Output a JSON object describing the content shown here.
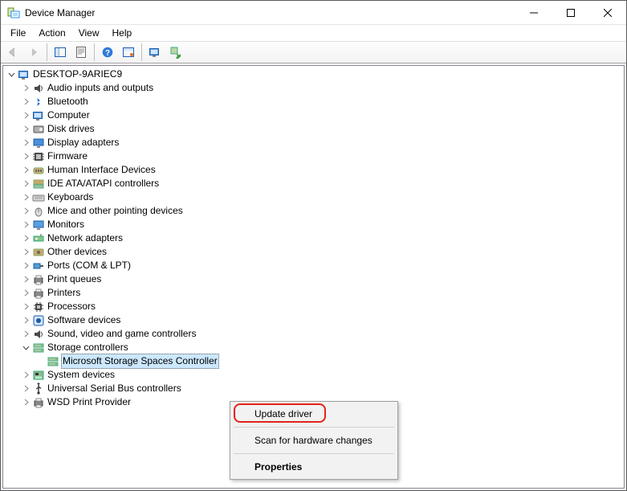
{
  "window": {
    "title": "Device Manager"
  },
  "menu": {
    "file": "File",
    "action": "Action",
    "view": "View",
    "help": "Help"
  },
  "tree": {
    "root": "DESKTOP-9ARIEC9",
    "nodes": [
      {
        "label": "Audio inputs and outputs",
        "icon": "audio"
      },
      {
        "label": "Bluetooth",
        "icon": "bluetooth"
      },
      {
        "label": "Computer",
        "icon": "computer"
      },
      {
        "label": "Disk drives",
        "icon": "disk"
      },
      {
        "label": "Display adapters",
        "icon": "display"
      },
      {
        "label": "Firmware",
        "icon": "firmware"
      },
      {
        "label": "Human Interface Devices",
        "icon": "hid"
      },
      {
        "label": "IDE ATA/ATAPI controllers",
        "icon": "ide"
      },
      {
        "label": "Keyboards",
        "icon": "keyboard"
      },
      {
        "label": "Mice and other pointing devices",
        "icon": "mouse"
      },
      {
        "label": "Monitors",
        "icon": "monitor"
      },
      {
        "label": "Network adapters",
        "icon": "network"
      },
      {
        "label": "Other devices",
        "icon": "other"
      },
      {
        "label": "Ports (COM & LPT)",
        "icon": "ports"
      },
      {
        "label": "Print queues",
        "icon": "printq"
      },
      {
        "label": "Printers",
        "icon": "printer"
      },
      {
        "label": "Processors",
        "icon": "cpu"
      },
      {
        "label": "Software devices",
        "icon": "software"
      },
      {
        "label": "Sound, video and game controllers",
        "icon": "sound"
      },
      {
        "label": "Storage controllers",
        "icon": "storage",
        "expanded": true,
        "children": [
          {
            "label": "Microsoft Storage Spaces Controller",
            "icon": "storage",
            "selected": true
          }
        ]
      },
      {
        "label": "System devices",
        "icon": "system"
      },
      {
        "label": "Universal Serial Bus controllers",
        "icon": "usb"
      },
      {
        "label": "WSD Print Provider",
        "icon": "printq"
      }
    ]
  },
  "context_menu": {
    "update": "Update driver",
    "scan": "Scan for hardware changes",
    "properties": "Properties"
  }
}
